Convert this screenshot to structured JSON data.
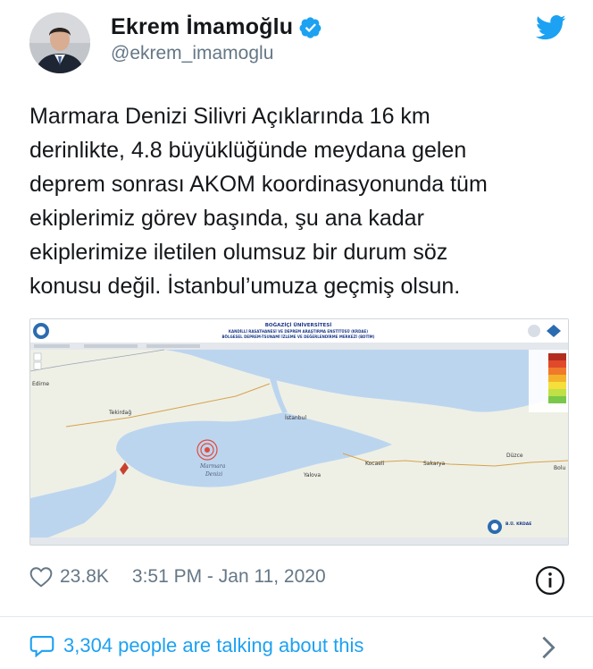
{
  "author": {
    "name": "Ekrem İmamoğlu",
    "handle": "@ekrem_imamoglu"
  },
  "icons": {
    "verified": "verified-badge-icon",
    "brand": "twitter-bird-icon",
    "like": "heart-icon",
    "info": "info-icon",
    "reply": "comment-bubble-icon",
    "more": "chevron-right-icon"
  },
  "tweet": {
    "text": "Marmara Denizi Silivri Açıklarında 16 km\nderinlikte, 4.8 büyüklüğünde meydana gelen\ndeprem sonrası AKOM koordinasyonunda tüm\nekiplerimiz görev başında, şu ana kadar\nekiplerimize iletilen olumsuz bir durum söz\nkonusu değil. İstanbul’umuza geçmiş olsun."
  },
  "map": {
    "header_line1": "BOĞAZİÇİ ÜNİVERSİTESİ",
    "header_line2": "KANDİLLİ RASATHANESİ VE DEPREM ARAŞTIRMA ENSTİTÜSÜ (KRDAE)",
    "header_line3": "BÖLGESEL DEPREM-TSUNAMİ İZLEME VE DEĞERLENDİRME MERKEZİ (BDTİM)",
    "places": {
      "istanbul": "İstanbul",
      "tekirdag": "Tekirdağ",
      "marmara": "Marmara",
      "denizi": "Denizi",
      "yalova": "Yalova",
      "kocaeli": "Kocaeli",
      "sakarya": "Sakarya",
      "duzce": "Düzce",
      "bolu": "Bolu",
      "edirne": "Edirne"
    },
    "logo_text": "B.Ü. KRDAE",
    "colors": {
      "sea": "#bcd5ef",
      "land": "#eef0e6",
      "epicenter": "#e24a3b"
    }
  },
  "meta": {
    "likes": "23.8K",
    "timestamp": "3:51 PM - Jan 11, 2020"
  },
  "footer": {
    "talking": "3,304 people are talking about this"
  },
  "colors": {
    "twitter_blue": "#1da1f2",
    "muted": "#657786",
    "text": "#14171a"
  }
}
